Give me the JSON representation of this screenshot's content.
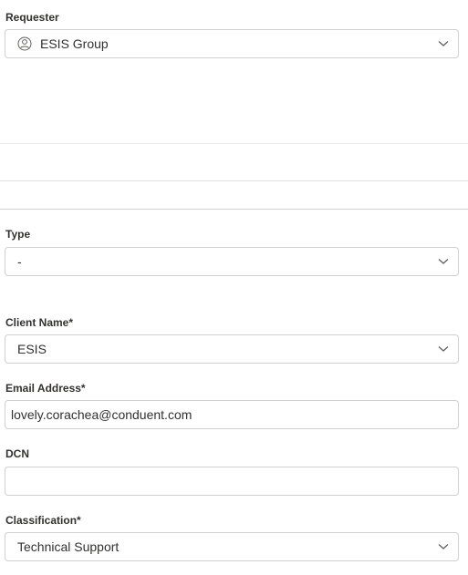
{
  "requester": {
    "label": "Requester",
    "value": "ESIS Group",
    "icon": "person-circle-icon"
  },
  "type": {
    "label": "Type",
    "value": "-"
  },
  "client_name": {
    "label": "Client Name*",
    "value": "ESIS"
  },
  "email": {
    "label": "Email Address*",
    "value": "lovely.corachea@conduent.com"
  },
  "dcn": {
    "label": "DCN",
    "value": ""
  },
  "classification": {
    "label": "Classification*",
    "value": "Technical Support"
  },
  "colors": {
    "border": "#d2d0ce",
    "divider": "#edebe9",
    "text": "#323130"
  }
}
